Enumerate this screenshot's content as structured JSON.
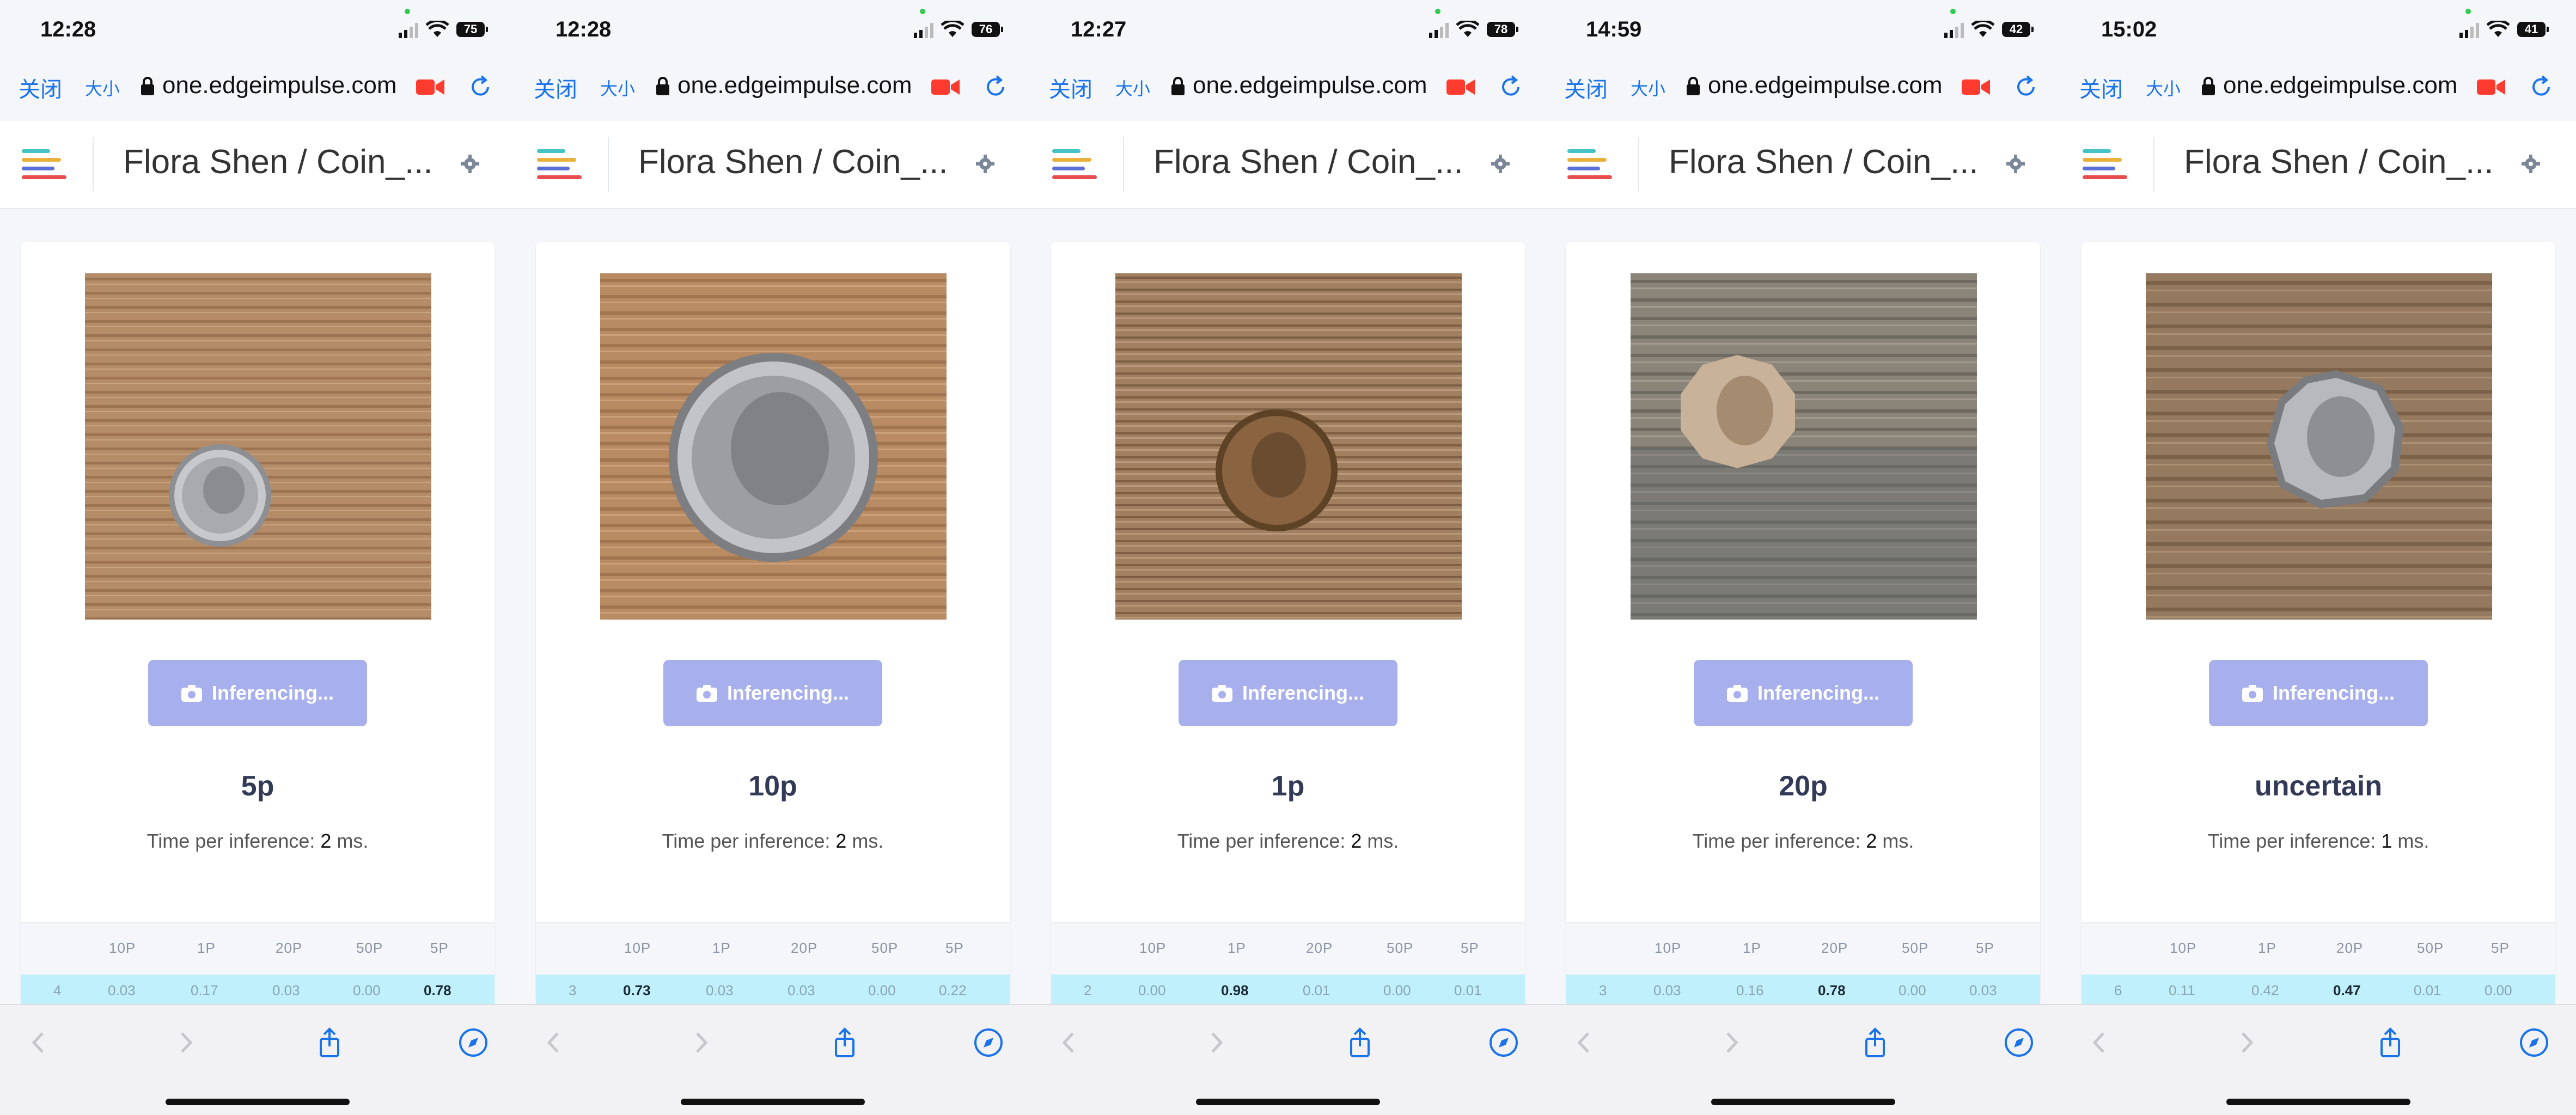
{
  "common": {
    "close": "关闭",
    "font_size": "大小",
    "url": "one.edgeimpulse.com",
    "project_title": "Flora Shen / Coin_...",
    "infer_button": "Inferencing...",
    "time_prefix": "Time per inference:",
    "time_suffix": "ms.",
    "columns": [
      "10P",
      "1P",
      "20P",
      "50P",
      "5P"
    ],
    "icons": [
      "signal-icon",
      "wifi-icon",
      "battery-icon",
      "lock-icon",
      "camera-icon",
      "reload-icon",
      "logo-icon",
      "settings-icon",
      "back-icon",
      "forward-icon",
      "share-icon",
      "compass-icon"
    ],
    "accent": "#1a73e8",
    "button_color": "#a7b0ec",
    "row_highlight": "#bff0fb"
  },
  "screens": [
    {
      "time": "12:28",
      "battery": "75",
      "result": "5p",
      "time_value": "2",
      "row": [
        "4",
        "0.03",
        "0.17",
        "0.03",
        "0.00",
        "0.78"
      ],
      "coin": "5p"
    },
    {
      "time": "12:28",
      "battery": "76",
      "result": "10p",
      "time_value": "2",
      "row": [
        "3",
        "0.73",
        "0.03",
        "0.03",
        "0.00",
        "0.22"
      ],
      "coin": "10p"
    },
    {
      "time": "12:27",
      "battery": "78",
      "result": "1p",
      "time_value": "2",
      "row": [
        "2",
        "0.00",
        "0.98",
        "0.01",
        "0.00",
        "0.01"
      ],
      "coin": "1p"
    },
    {
      "time": "14:59",
      "battery": "42",
      "result": "20p",
      "time_value": "2",
      "row": [
        "3",
        "0.03",
        "0.16",
        "0.78",
        "0.00",
        "0.03"
      ],
      "coin": "20p"
    },
    {
      "time": "15:02",
      "battery": "41",
      "result": "uncertain",
      "time_value": "1",
      "row": [
        "6",
        "0.11",
        "0.42",
        "0.47",
        "0.01",
        "0.00"
      ],
      "coin": "50p"
    }
  ]
}
